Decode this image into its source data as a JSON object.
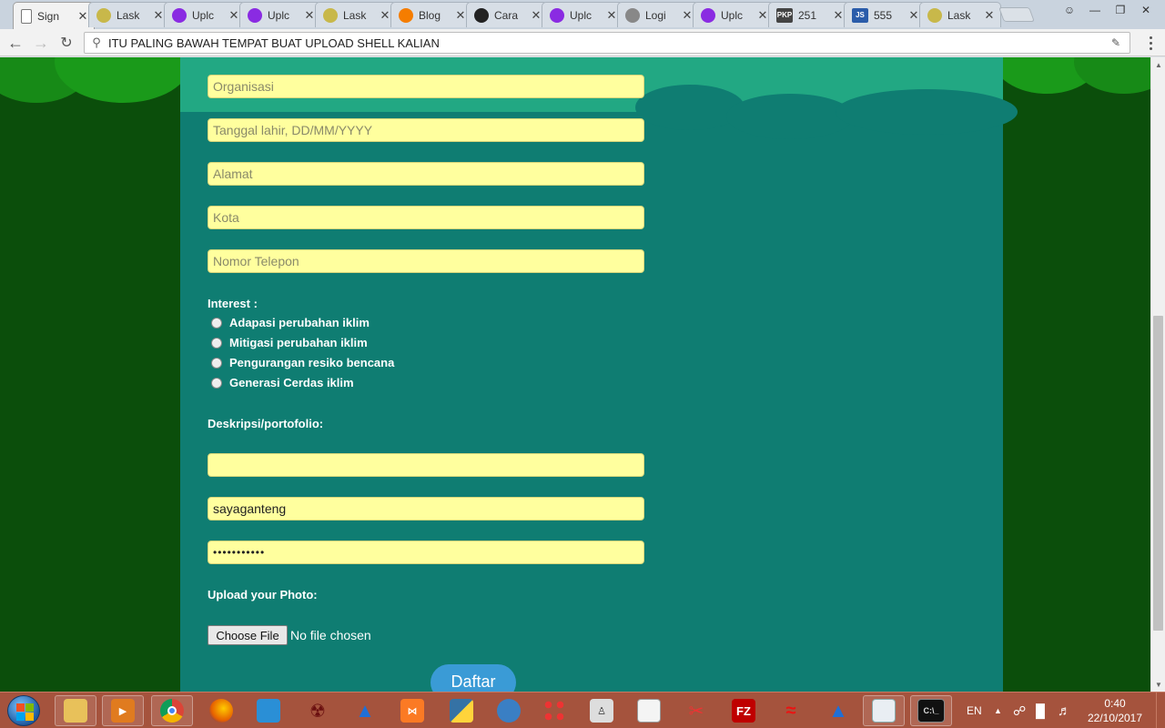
{
  "browser": {
    "tabs": [
      {
        "label": "Sign",
        "icon": "page-icon",
        "color": "#ffffff"
      },
      {
        "label": "Lask",
        "icon": "smiley-icon",
        "color": "#c8b84a"
      },
      {
        "label": "Uplc",
        "icon": "cloud-icon",
        "color": "#8a2be2"
      },
      {
        "label": "Uplc",
        "icon": "cloud-icon",
        "color": "#8a2be2"
      },
      {
        "label": "Lask",
        "icon": "smiley-icon",
        "color": "#c8b84a"
      },
      {
        "label": "Blog",
        "icon": "blogger-icon",
        "color": "#f57d00"
      },
      {
        "label": "Cara",
        "icon": "circle-icon",
        "color": "#222222"
      },
      {
        "label": "Uplc",
        "icon": "cloud-icon",
        "color": "#8a2be2"
      },
      {
        "label": "Logi",
        "icon": "key-icon",
        "color": "#888888"
      },
      {
        "label": "Uplc",
        "icon": "cloud-icon",
        "color": "#8a2be2"
      },
      {
        "label": "251",
        "icon": "pkp-icon",
        "color": "#444444",
        "prefix": "PKP"
      },
      {
        "label": "555",
        "icon": "js-icon",
        "color": "#2a5caa",
        "prefix": "JS"
      },
      {
        "label": "Lask",
        "icon": "smiley-icon",
        "color": "#c8b84a"
      }
    ],
    "address": "ITU PALING BAWAH TEMPAT BUAT UPLOAD SHELL KALIAN"
  },
  "form": {
    "fields": [
      {
        "name": "organisasi",
        "placeholder": "Organisasi",
        "value": ""
      },
      {
        "name": "tanggal-lahir",
        "placeholder": "Tanggal lahir, DD/MM/YYYY",
        "value": ""
      },
      {
        "name": "alamat",
        "placeholder": "Alamat",
        "value": ""
      },
      {
        "name": "kota",
        "placeholder": "Kota",
        "value": ""
      },
      {
        "name": "nomor-telepon",
        "placeholder": "Nomor Telepon",
        "value": ""
      }
    ],
    "interest_label": "Interest :",
    "interests": [
      "Adapasi perubahan iklim",
      "Mitigasi perubahan iklim",
      "Pengurangan resiko bencana",
      "Generasi Cerdas iklim"
    ],
    "deskripsi_label": "Deskripsi/portofolio:",
    "deskripsi_value": "",
    "username_value": "sayaganteng",
    "password_value": "•••••••••••",
    "upload_label": "Upload your Photo:",
    "choose_file": "Choose File",
    "no_file": "No file chosen",
    "submit": "Daftar"
  },
  "taskbar": {
    "language": "EN",
    "time": "0:40",
    "date": "22/10/2017"
  }
}
